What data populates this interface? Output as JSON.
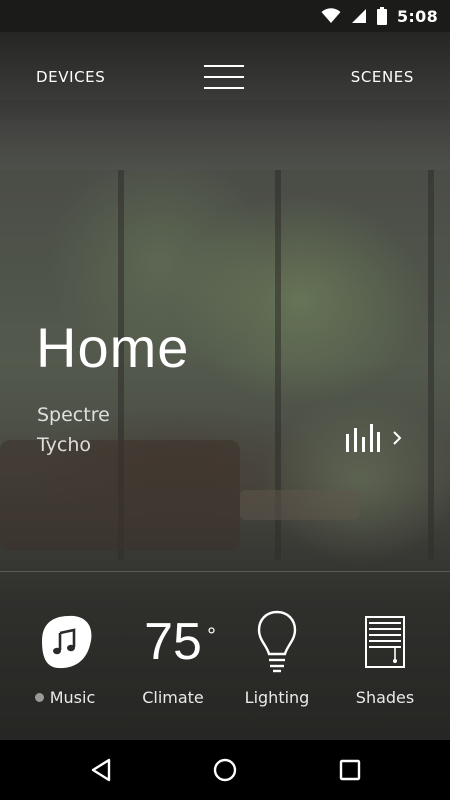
{
  "status_bar": {
    "time": "5:08"
  },
  "top_nav": {
    "devices_label": "DEVICES",
    "scenes_label": "SCENES"
  },
  "hero": {
    "title": "Home",
    "speakers": [
      "Spectre",
      "Tycho"
    ]
  },
  "tiles": {
    "music": {
      "label": "Music",
      "icon": "music-note-icon"
    },
    "climate": {
      "label": "Climate",
      "value": "75",
      "unit": "°"
    },
    "lighting": {
      "label": "Lighting",
      "icon": "lightbulb-icon"
    },
    "shades": {
      "label": "Shades",
      "icon": "shades-icon"
    }
  },
  "colors": {
    "music_badge": "#ffffff",
    "music_note": "#2a2a28",
    "status_bar": "#1b1b1a",
    "nav_bar": "#000000"
  }
}
